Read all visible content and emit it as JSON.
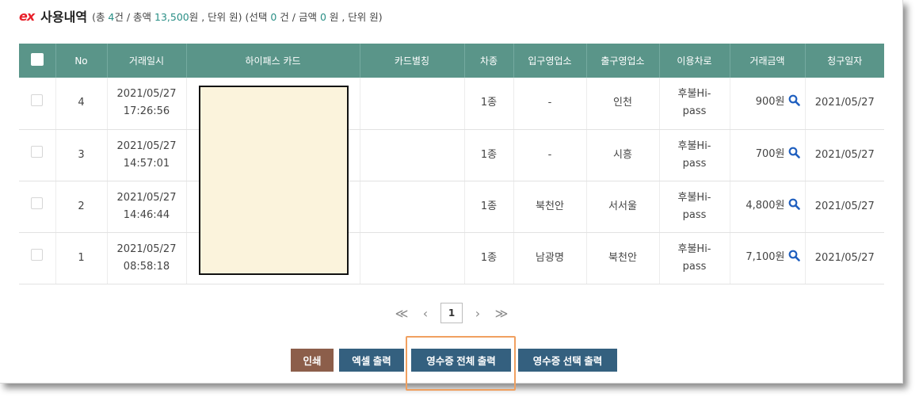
{
  "header": {
    "logo": "ex",
    "title": "사용내역",
    "summary": {
      "p1": "(총 ",
      "count": "4",
      "p2": "건 / 총액 ",
      "total": "13,500",
      "p3": "원 , 단위 원) (선택 ",
      "selected": "0",
      "p4": " 건 / 금액 ",
      "selected_amount": "0",
      "p5": " 원 , 단위 원)"
    }
  },
  "table": {
    "columns": [
      "No",
      "거래일시",
      "하이패스 카드",
      "카드별칭",
      "차종",
      "입구영업소",
      "출구영업소",
      "이용차로",
      "거래금액",
      "청구일자"
    ],
    "rows": [
      {
        "no": "4",
        "date": "2021/05/27",
        "time": "17:26:56",
        "card": "",
        "alias": "",
        "vehicle": "1종",
        "entry": "-",
        "exit": "인천",
        "lane1": "후불Hi-",
        "lane2": "pass",
        "amount": "900원",
        "billing": "2021/05/27"
      },
      {
        "no": "3",
        "date": "2021/05/27",
        "time": "14:57:01",
        "card": "",
        "alias": "",
        "vehicle": "1종",
        "entry": "-",
        "exit": "시흥",
        "lane1": "후불Hi-",
        "lane2": "pass",
        "amount": "700원",
        "billing": "2021/05/27"
      },
      {
        "no": "2",
        "date": "2021/05/27",
        "time": "14:46:44",
        "card": "",
        "alias": "",
        "vehicle": "1종",
        "entry": "북천안",
        "exit": "서서울",
        "lane1": "후불Hi-",
        "lane2": "pass",
        "amount": "4,800원",
        "billing": "2021/05/27"
      },
      {
        "no": "1",
        "date": "2021/05/27",
        "time": "08:58:18",
        "card": "",
        "alias": "",
        "vehicle": "1종",
        "entry": "남광명",
        "exit": "북천안",
        "lane1": "후불Hi-",
        "lane2": "pass",
        "amount": "7,100원",
        "billing": "2021/05/27"
      }
    ]
  },
  "pagination": {
    "first": "≪",
    "prev": "‹",
    "current": "1",
    "next": "›",
    "last": "≫"
  },
  "buttons": {
    "print": "인쇄",
    "excel": "엑셀 출력",
    "receipt_all": "영수증 전체 출력",
    "receipt_selected": "영수증 선택 출력"
  },
  "colors": {
    "table_header": "#5a9589",
    "accent_number": "#2a8f86",
    "print_button": "#8c5e4a",
    "action_button": "#34607f",
    "logo": "#e8202a",
    "highlight_border": "#f0a060",
    "redaction_fill": "#fbf3dc"
  },
  "icons": {
    "amount_detail": "search-icon"
  }
}
